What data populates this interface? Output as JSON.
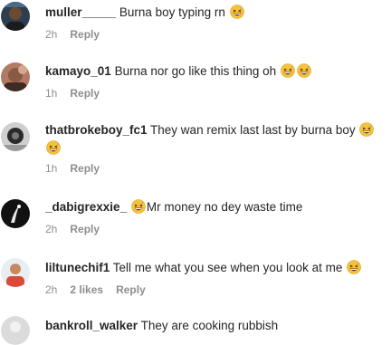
{
  "comments": [
    {
      "username": "muller_____",
      "text": "Burna boy typing rn",
      "time": "2h",
      "reply": "Reply",
      "likes": ""
    },
    {
      "username": "kamayo_01",
      "text": "Burna nor go like this thing oh",
      "time": "1h",
      "reply": "Reply",
      "likes": ""
    },
    {
      "username": "thatbrokeboy_fc1",
      "text": "They wan remix last last by burna boy",
      "time": "1h",
      "reply": "Reply",
      "likes": ""
    },
    {
      "username": "_dabigrexxie_",
      "text": "Mr money no dey waste time",
      "time": "2h",
      "reply": "Reply",
      "likes": ""
    },
    {
      "username": "liltunechif1",
      "text": "Tell me what you see when you look at me",
      "time": "2h",
      "reply": "Reply",
      "likes": "2 likes"
    },
    {
      "username": "bankroll_walker",
      "text": "They are cooking rubbish",
      "time": "",
      "reply": "",
      "likes": ""
    }
  ],
  "icons": {
    "emoji": "grinning-squinting-face-with-sweat-icon"
  },
  "colors": {
    "username": "#262626",
    "meta": "#8e8e8e",
    "emoji_face": "#f5c33b"
  }
}
